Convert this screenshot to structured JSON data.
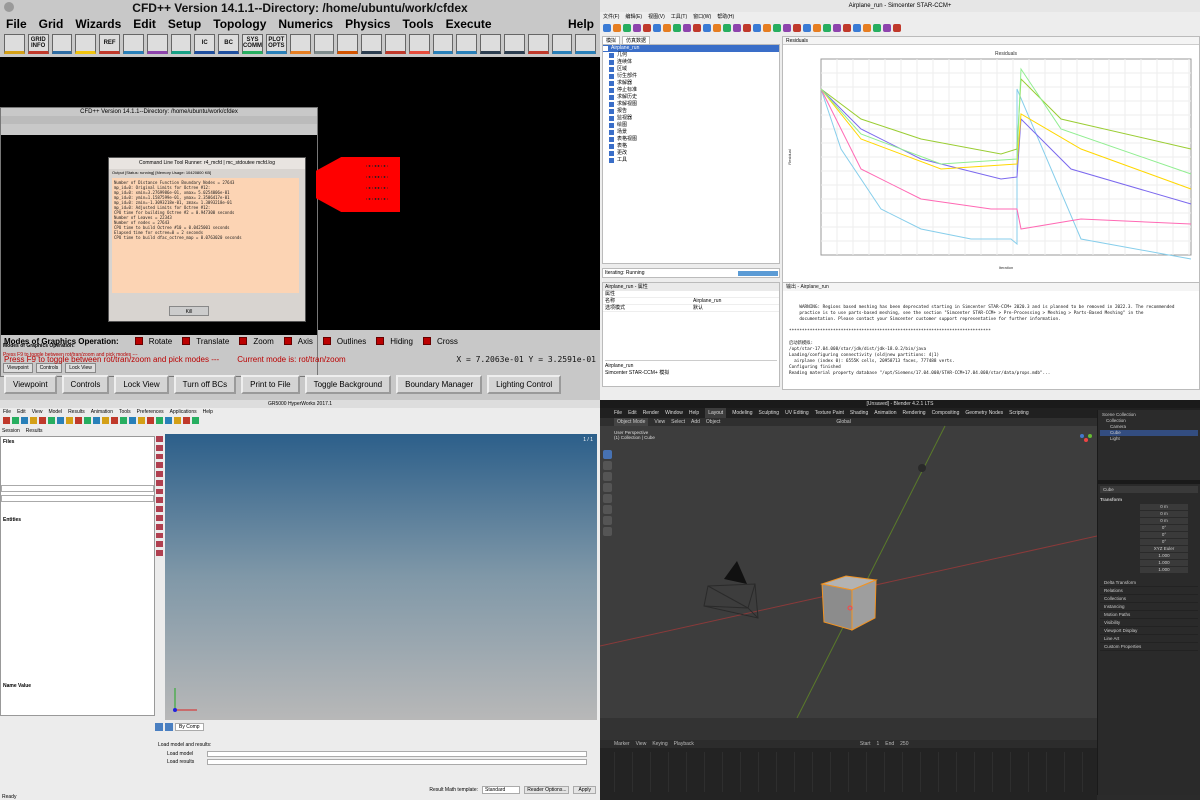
{
  "cfd": {
    "title": "CFD++ Version 14.1.1--Directory: /home/ubuntu/work/cfdex",
    "menu": [
      "File",
      "Grid",
      "Wizards",
      "Edit",
      "Setup",
      "Topology",
      "Numerics",
      "Physics",
      "Tools",
      "Execute"
    ],
    "help": "Help",
    "toolbar": [
      "",
      "GRID INFO",
      "",
      "",
      "REF",
      "",
      "",
      "",
      "IC",
      "BC",
      "SYS COMM",
      "PLOT OPTS",
      "",
      "",
      "",
      "",
      "",
      "",
      "",
      "",
      "",
      "",
      "",
      "",
      ""
    ],
    "inner_title": "CFD++ Version 14.1.1--Directory: /home/ubuntu/work/cfdex",
    "dialog_title": "Command Line Tool Runner: r4_mcfd | mc_stdoutee mcfd.log",
    "dialog_status": "Output [Status: running] [Memory Usage: 10420800 KB]",
    "dialog_lines": [
      "Number of Distance Function Boundary Nodes = 27643",
      "mp_id=0: Original Limits for Octree #12:",
      "mp_id=0: xmin=3.2769986e-01, xmax= 5.0254006e-01",
      "mp_id=0: ymin=1.1587599e-01, ymax= 2.3586417e-01",
      "mp_id=0: zmin=-1.3093218e-01, zmax= 1.3093218e-01",
      "mp_id=0: Adjusted Limits for Octree #12:",
      "CPU time for building Octree #2 = 0.947300 seconds",
      "Number of Leaves = 22343",
      "Number of nodes = 27643",
      "CPU time to build Octree #10 = 0.0425001 seconds",
      "Elapsed time for octree=0 = 2 seconds",
      "CPU time to build dfac_octree_map = 0.0763020 seconds"
    ],
    "modes_label": "Modes of Graphics Operation:",
    "modes": [
      "Rotate",
      "Translate",
      "Zoom",
      "Axis",
      "Outlines",
      "Hiding",
      "Cross"
    ],
    "status_left": "Press F9 to toggle between rot/tran/zoom and pick modes ---",
    "status_mode": "Current mode is: rot/tran/zoom",
    "coords": "X = 7.2063e-01  Y = 3.2591e-01",
    "buttons": [
      "Viewpoint",
      "Controls",
      "Lock View",
      "Turn off BCs",
      "Print to File",
      "Toggle Background",
      "Boundary Manager",
      "Lighting Control"
    ],
    "inner_buttons": [
      "Viewpoint",
      "Controls",
      "Lock View",
      "Kill"
    ]
  },
  "star": {
    "title": "Airplane_run - Simcenter STAR-CCM+",
    "menu": [
      "文件(F)",
      "编辑(E)",
      "视图(V)",
      "工具(T)",
      "窗口(W)",
      "帮助(H)"
    ],
    "tree_tabs": [
      "模拟",
      "仿真数据"
    ],
    "tree_root": "Airplane_run",
    "tree": [
      "几何",
      "连续体",
      "区域",
      "衍生部件",
      "求解器",
      "停止标准",
      "求解历史",
      "求解视图",
      "报告",
      "监视器",
      "绘图",
      "场景",
      "表格视图",
      "表格",
      "更改",
      "工具"
    ],
    "plot_tab": "Residuals",
    "plot_title": "Residuals",
    "xlabel": "Iteration",
    "ylabel": "Residual",
    "status": "Iterating: Running",
    "props_title": "Airplane_run - 属性",
    "props_rows": [
      [
        "属性",
        ""
      ],
      [
        "名称",
        "Airplane_run"
      ],
      [
        "选项模式",
        "默认"
      ]
    ],
    "props_footer": "Airplane_run",
    "props_footer2": "Simcenter STAR-CCM+ 模拟",
    "console_tab": "输出 - Airplane_run",
    "console": "WARNING: Regions based meshing has been deprecated starting in Simcenter STAR-CCM+ 2020.3 and is planned to be removed in 2022.3. The recommended\n    practice is to use parts-based meshing, see the section \"Simcenter STAR-CCM+ > Pre-Processing > Meshing > Parts-Based Meshing\" in the\n    documentation. Please contact your Simcenter customer support representative for further information.\n\n******************************************************************************\n\n启动新模拟:\n/opt/star-17.04.008/star/jdk/dist/jdk-18.0.2/bin/java\nLoading/configuring connectivity (old|new partitions: 4|1)\n  airplane (index 0): 6555K cells, 20958713 faces, 777488 verts.\nConfiguring finished\nReading material property database \"/opt/Siemens/17.04.008/STAR-CCM+17.04.008/star/data/props.mdb\"..."
  },
  "hw": {
    "title": "GR5000 HyperWorks 2017.1",
    "menu": [
      "File",
      "Edit",
      "View",
      "Model",
      "Results",
      "Animation",
      "Tools",
      "Preferences",
      "Applications",
      "Help"
    ],
    "tab_session": "Session",
    "tab_results": "Results",
    "files_label": "Files",
    "entities_label": "Entities",
    "name_value": "Name   Value",
    "load_model_label": "Load model and results:",
    "load_model": "Load model",
    "load_results": "Load results",
    "result_math": "Result Math template:",
    "standard": "Standard",
    "reader_options": "Reader Options...",
    "apply": "Apply",
    "status": "Ready",
    "by_comp": "By Comp",
    "page": "1 / 1"
  },
  "blender": {
    "title": "[Unsaved] - Blender 4.2.1 LTS",
    "menu": [
      "File",
      "Edit",
      "Render",
      "Window",
      "Help"
    ],
    "workspaces": [
      "Layout",
      "Modeling",
      "Sculpting",
      "UV Editing",
      "Texture Paint",
      "Shading",
      "Animation",
      "Rendering",
      "Compositing",
      "Geometry Nodes",
      "Scripting"
    ],
    "mode": "Object Mode",
    "view_menu": [
      "View",
      "Select",
      "Add",
      "Object"
    ],
    "vp_label": "User Perspective",
    "vp_sub": "(1) Collection | Cube",
    "global": "Global",
    "outliner": [
      "Scene Collection",
      "Collection",
      "Camera",
      "Cube",
      "Light"
    ],
    "props_obj": "Cube",
    "transform": "Transform",
    "loc": [
      "0 m",
      "0 m",
      "0 m"
    ],
    "rot": [
      "0°",
      "0°",
      "0°"
    ],
    "mode_rot": "XYZ Euler",
    "scale": [
      "1.000",
      "1.000",
      "1.000"
    ],
    "sections": [
      "Delta Transform",
      "Relations",
      "Collections",
      "Instancing",
      "Motion Paths",
      "Visibility",
      "Viewport Display",
      "Line Art",
      "Custom Properties"
    ],
    "tl_menu": [
      "Playback",
      "Keying",
      "View",
      "Marker"
    ],
    "start": "Start",
    "start_v": "1",
    "end": "End",
    "end_v": "250",
    "frame": "1"
  }
}
